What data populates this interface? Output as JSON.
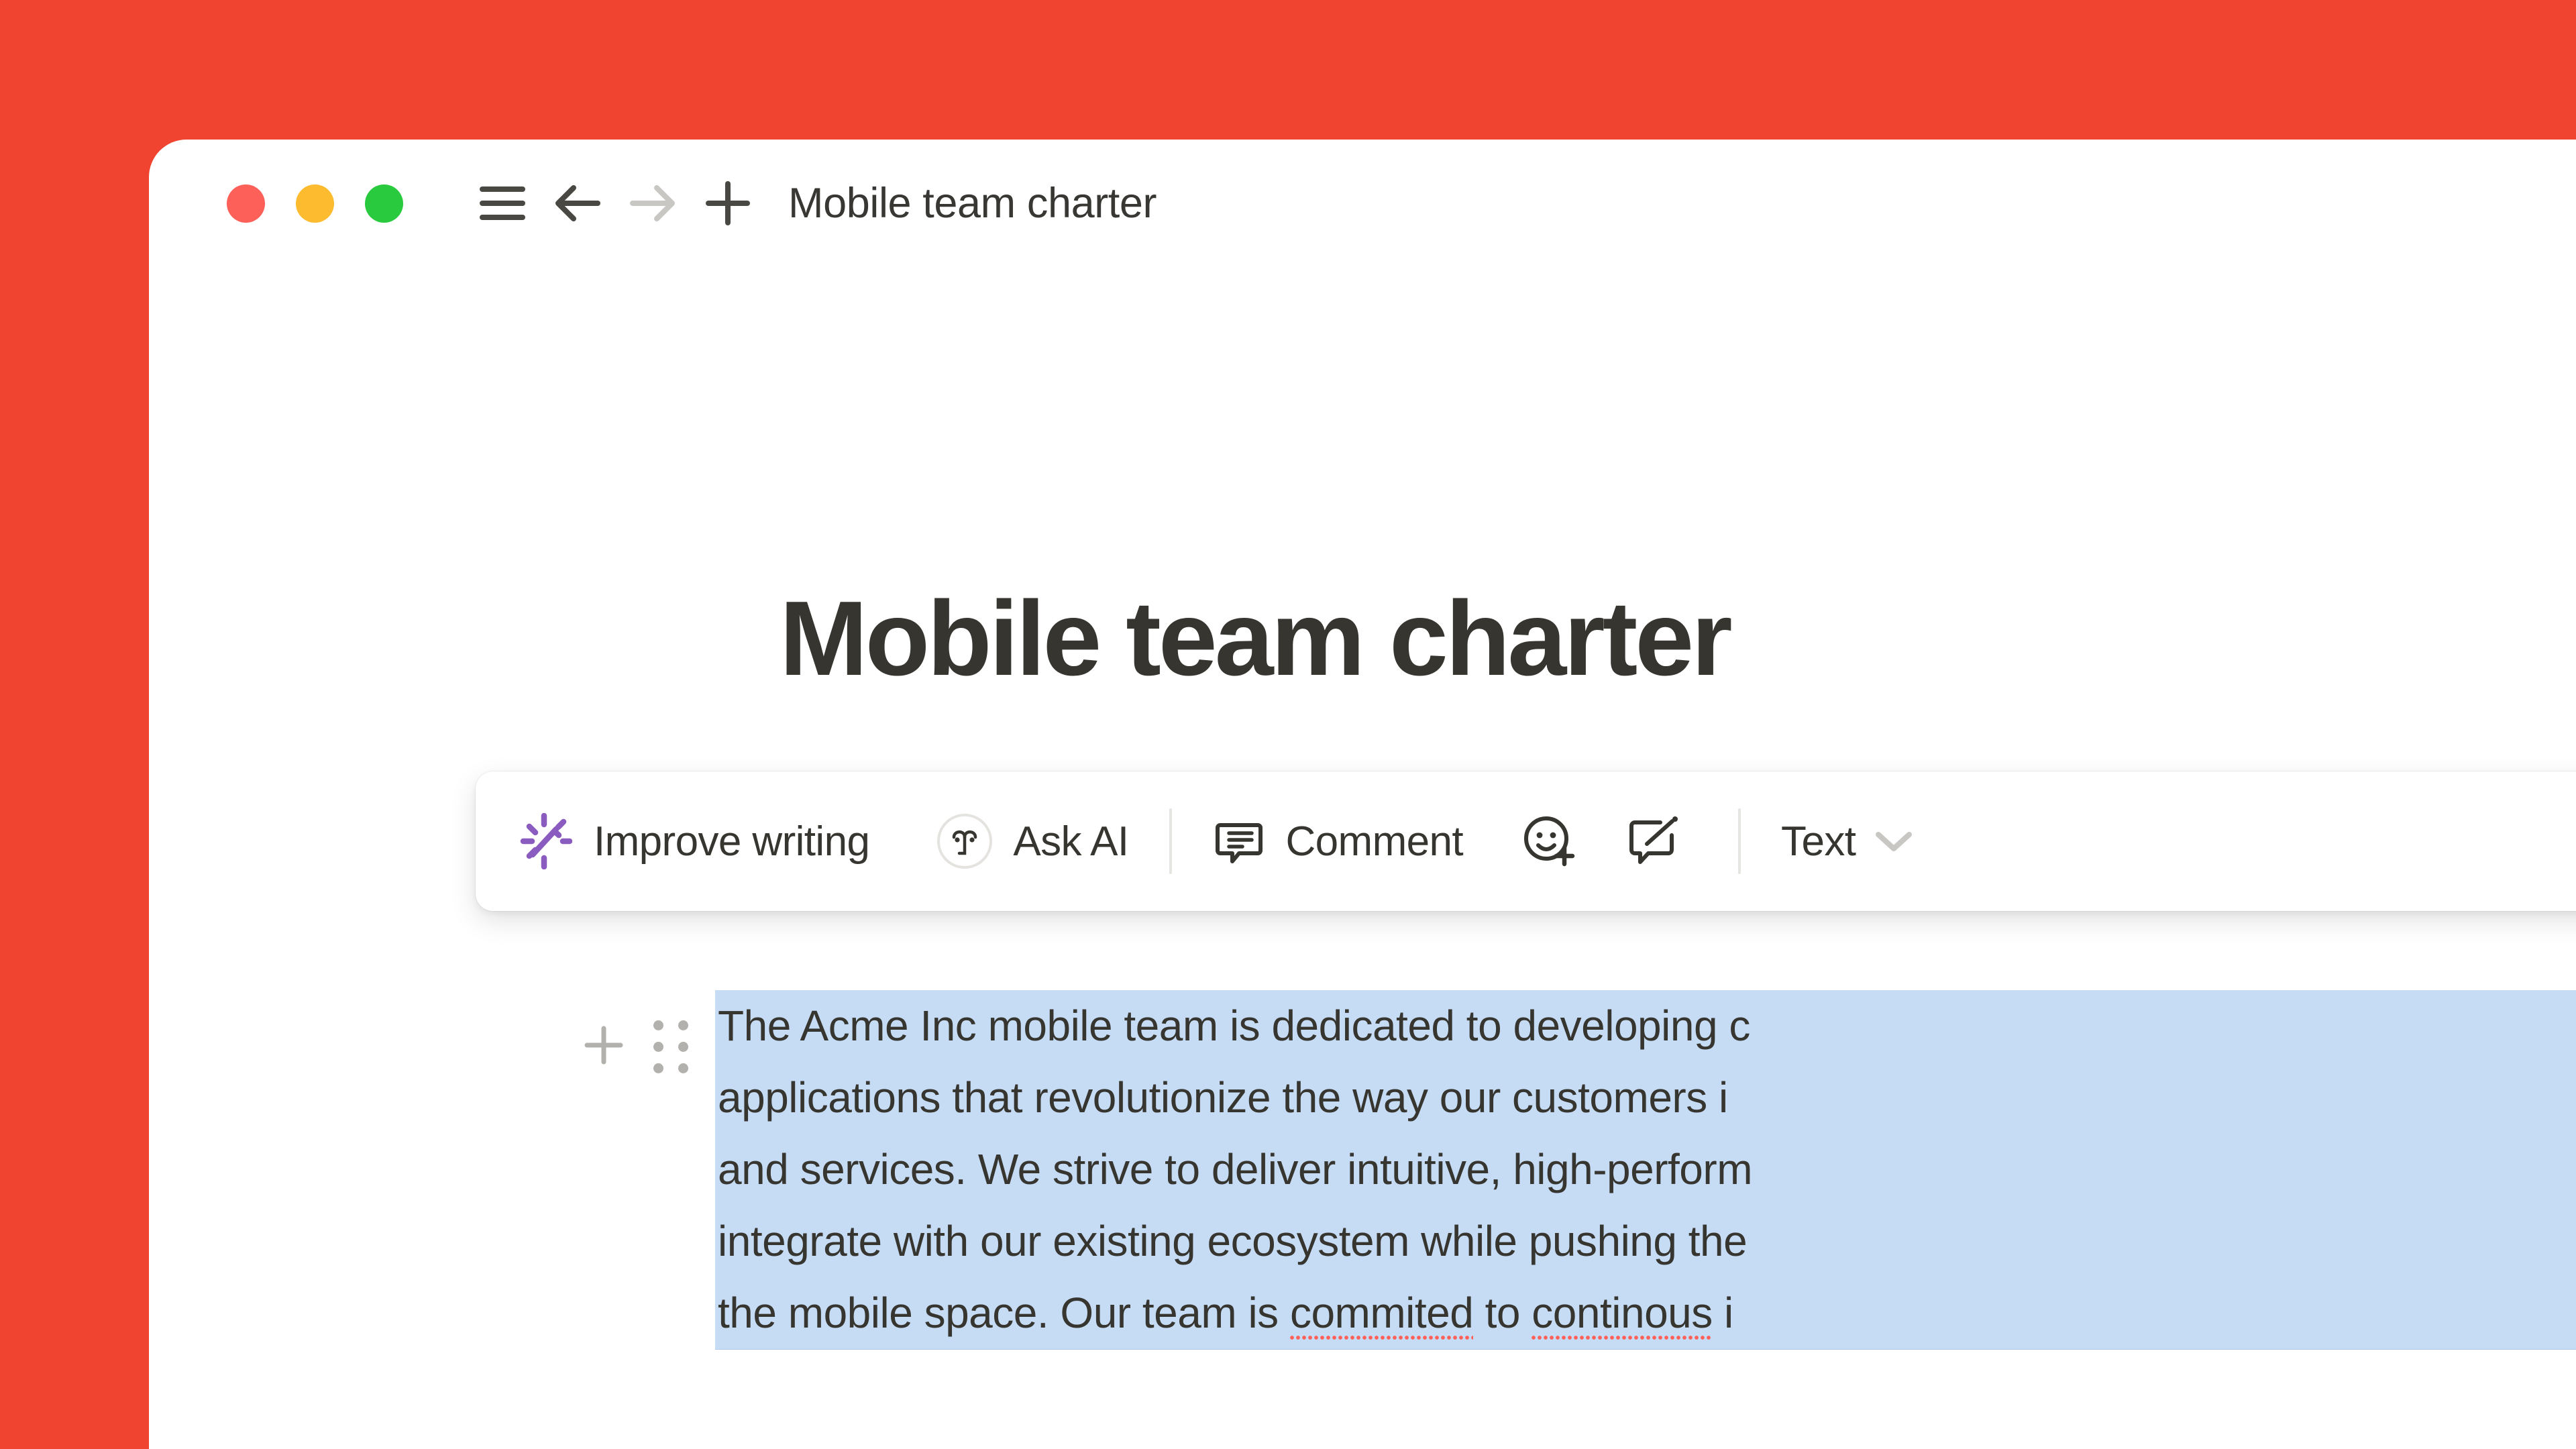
{
  "window": {
    "background_color": "#F04430",
    "surface_color": "#FFFFFF"
  },
  "titlebar": {
    "traffic_lights": [
      {
        "name": "close",
        "color": "#FC6058"
      },
      {
        "name": "minimize",
        "color": "#FDBC2F"
      },
      {
        "name": "maximize",
        "color": "#2ACA3E"
      }
    ],
    "nav": [
      {
        "icon": "hamburger-menu-icon",
        "state": "enabled"
      },
      {
        "icon": "arrow-left-icon",
        "state": "enabled"
      },
      {
        "icon": "arrow-right-icon",
        "state": "disabled"
      },
      {
        "icon": "plus-icon",
        "state": "enabled"
      }
    ],
    "breadcrumb": "Mobile team charter"
  },
  "document": {
    "title": "Mobile team charter",
    "paragraph_lines": [
      "The Acme Inc mobile team is dedicated to developing c",
      "applications that revolutionize the way our customers i",
      "and services. We strive to deliver intuitive, high-perform",
      "integrate with our existing ecosystem while pushing the",
      "the mobile space. Our team is "
    ],
    "last_line_parts": {
      "before": "the mobile space. Our team is ",
      "misspelled_one": "commited",
      "middle": " to ",
      "misspelled_two": "continous",
      "after": " i"
    },
    "selection_color": "#C6DCF5",
    "spellcheck_color": "#FF6159",
    "block_handles": [
      {
        "icon": "plus-icon"
      },
      {
        "icon": "drag-handle-icon"
      }
    ]
  },
  "toolbar": {
    "improve_writing_label": "Improve writing",
    "improve_writing_icon": "magic-wand-sparkle-icon",
    "improve_writing_accent": "#8B5CBF",
    "ask_ai_label": "Ask AI",
    "ask_ai_icon": "ai-face-circle-icon",
    "comment_label": "Comment",
    "comment_icon": "speech-bubble-lines-icon",
    "reaction_icon": "smiley-plus-icon",
    "comment_edit_icon": "speech-bubble-pencil-icon",
    "text_style_label": "Text",
    "text_style_chevron": "chevron-down-icon"
  }
}
